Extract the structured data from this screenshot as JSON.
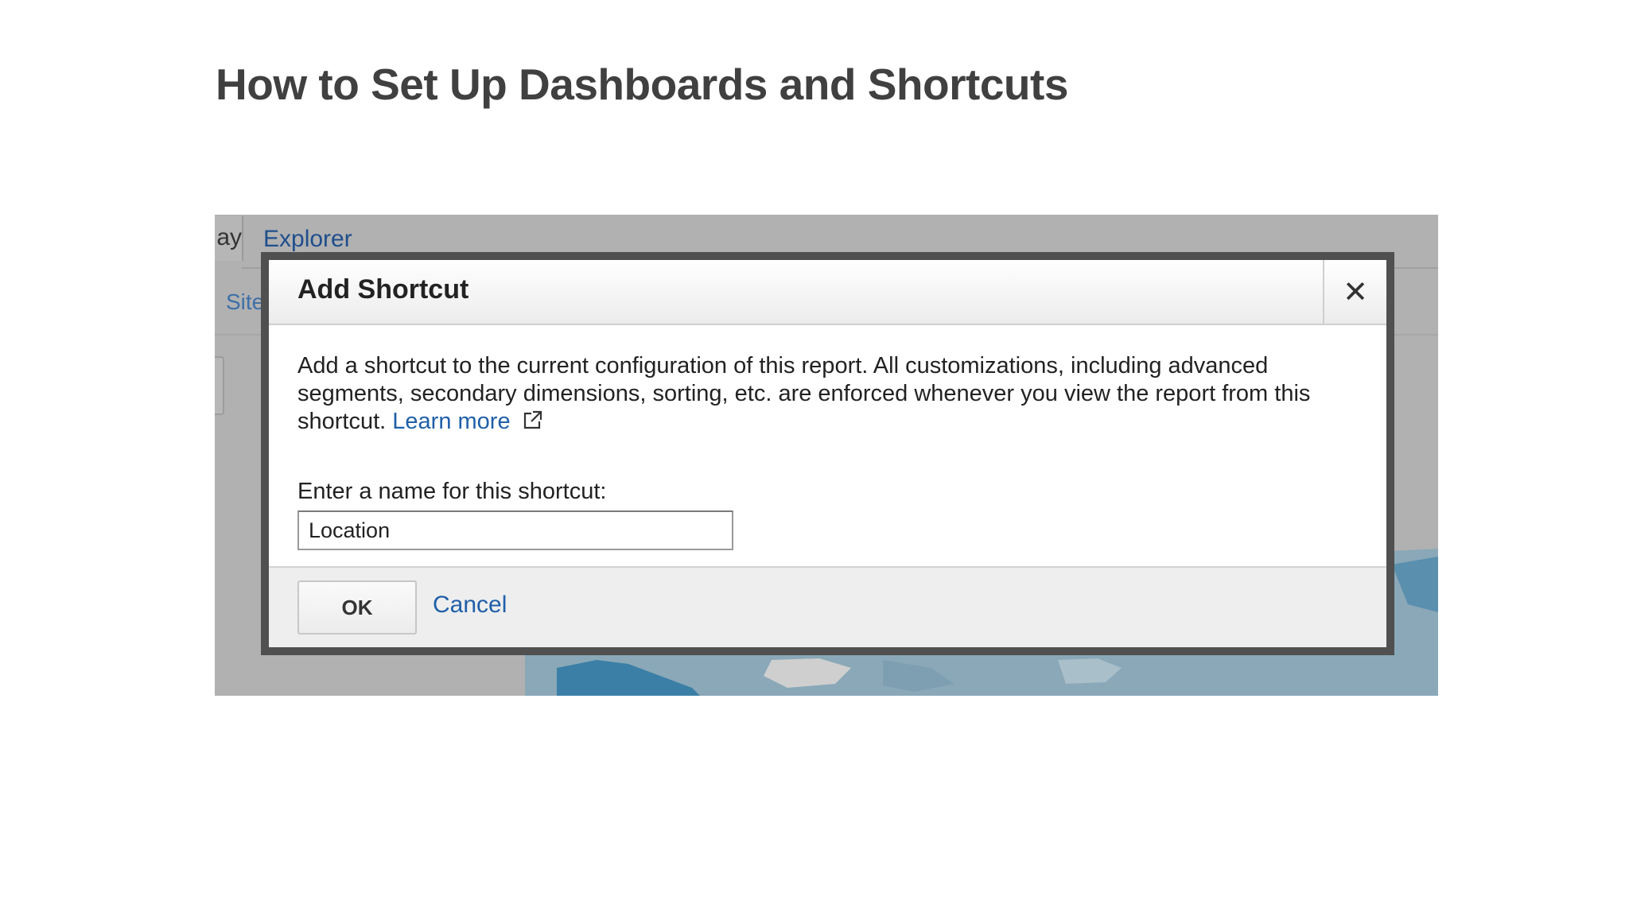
{
  "slide": {
    "title": "How to Set Up Dashboards and Shortcuts"
  },
  "background": {
    "active_tab": "ay",
    "explorer_tab": "Explorer",
    "site_label": "Site",
    "map_color": "#8aa8b8",
    "map_highlight_color": "#3b7fa6"
  },
  "dialog": {
    "title": "Add Shortcut",
    "close_icon": "close-icon",
    "description": "Add a shortcut to the current configuration of this report. All customizations, including advanced segments, secondary dimensions, sorting, etc. are enforced whenever you view the report from this shortcut.",
    "learn_more_label": "Learn more",
    "external_link_icon": "external-link-icon",
    "field_label": "Enter a name for this shortcut:",
    "field_value": "Location",
    "ok_label": "OK",
    "cancel_label": "Cancel"
  },
  "colors": {
    "link": "#1f5fa8",
    "dialog_border": "#505050",
    "overlay": "#b1b1b1",
    "title": "#404040"
  }
}
